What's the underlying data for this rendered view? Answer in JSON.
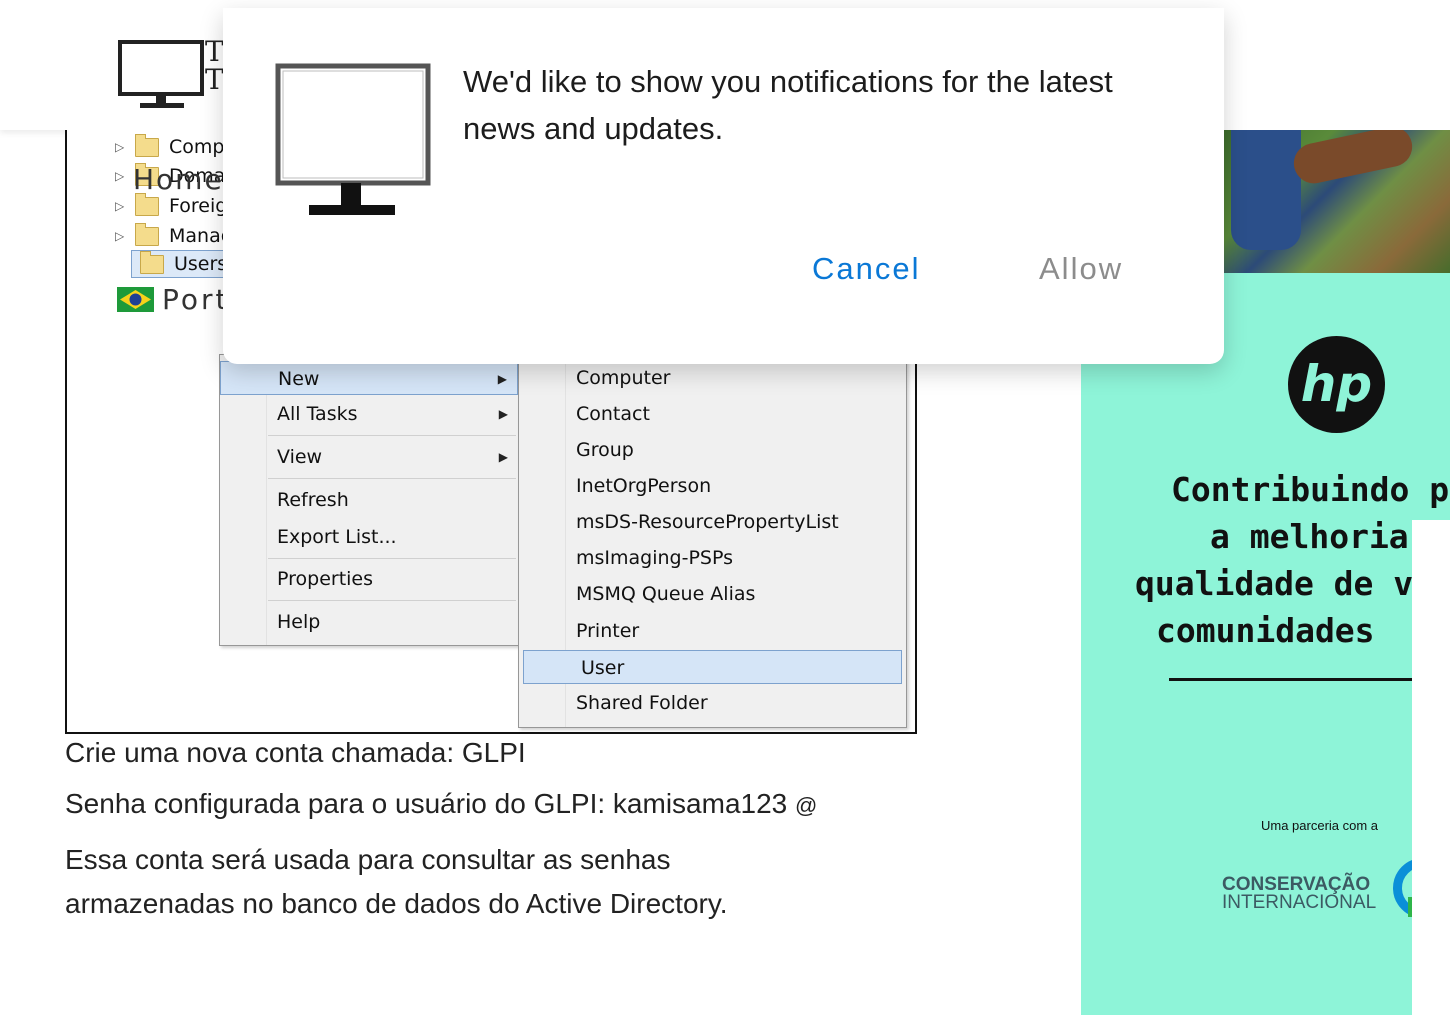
{
  "site": {
    "logo_text": "T T",
    "nav_home": "Home",
    "nav_lang": "Port"
  },
  "notification": {
    "message": "We'd like to show you notifications for the latest news and updates.",
    "cancel_label": "Cancel",
    "allow_label": "Allow"
  },
  "ad_tree": {
    "items": [
      {
        "label": "Comp"
      },
      {
        "label": "Doma"
      },
      {
        "label": "Foreig"
      },
      {
        "label": "Manag"
      },
      {
        "label": "Users"
      }
    ]
  },
  "context_menu": {
    "items": [
      "New",
      "All Tasks",
      "View",
      "Refresh",
      "Export List...",
      "Properties",
      "Help"
    ],
    "submenu_items": [
      "Computer",
      "Contact",
      "Group",
      "InetOrgPerson",
      "msDS-ResourcePropertyList",
      "msImaging-PSPs",
      "MSMQ Queue Alias",
      "Printer",
      "User",
      "Shared Folder"
    ]
  },
  "article": {
    "p1": "Crie uma nova conta chamada: GLPI",
    "p2_text": "Senha configurada para o usuário do GLPI: kamisama123 ",
    "p2_at": "@",
    "p3": "Essa conta será usada para consultar as senhas armazenadas no banco de dados do Active Directory."
  },
  "ad": {
    "brand": "hp",
    "headline": [
      "Contribuindo p",
      "a melhoria",
      "qualidade de vi",
      "comunidades"
    ],
    "partner": "Uma parceria com a",
    "org_line1": "CONSERVAÇÃO",
    "org_line2": "INTERNACIONAL",
    "bg_color": "#8ef4d8"
  },
  "colors": {
    "link_blue": "#0a78d6",
    "allow_gray": "#8c8c8c"
  }
}
